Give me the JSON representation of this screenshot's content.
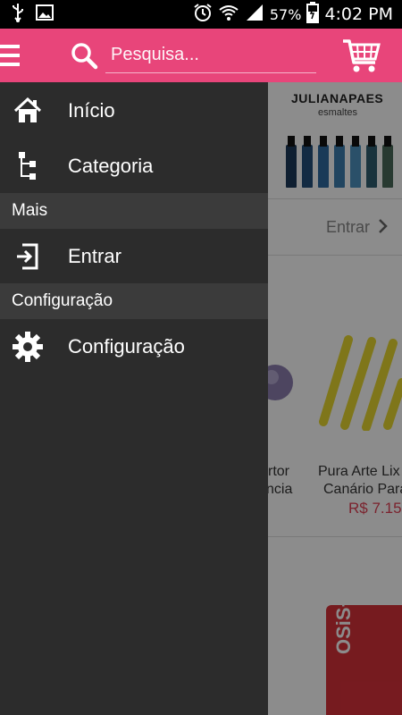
{
  "status_bar": {
    "battery_percent": "57%",
    "time": "4:02 PM",
    "icons": [
      "usb-icon",
      "image-icon",
      "alarm-icon",
      "wifi-icon",
      "signal-icon",
      "battery-icon"
    ]
  },
  "app_bar": {
    "search_placeholder": "Pesquisa...",
    "accent_color": "#e8457a",
    "icons": [
      "hamburger-menu-icon",
      "search-icon",
      "cart-icon"
    ]
  },
  "drawer": {
    "background": "#2c2c2c",
    "items": [
      {
        "label": "Início",
        "icon": "home-icon"
      },
      {
        "label": "Categoria",
        "icon": "category-tree-icon"
      }
    ],
    "section_mais": {
      "title": "Mais"
    },
    "items_mais": [
      {
        "label": "Entrar",
        "icon": "login-icon"
      }
    ],
    "section_config": {
      "title": "Configuração"
    },
    "items_config": [
      {
        "label": "Configuração",
        "icon": "gear-icon"
      }
    ]
  },
  "background_page": {
    "banner_brand": "JULIANAPAES",
    "banner_sub": "esmaltes",
    "login_link": "Entrar",
    "product_left_name_line1": "rtor",
    "product_left_name_line2": "ncia",
    "product_right_name_line1": "Pura Arte Lix",
    "product_right_name_line2": "Canário Para",
    "product_right_price": "R$ 7.15",
    "product_box_text": "OSiS+"
  }
}
